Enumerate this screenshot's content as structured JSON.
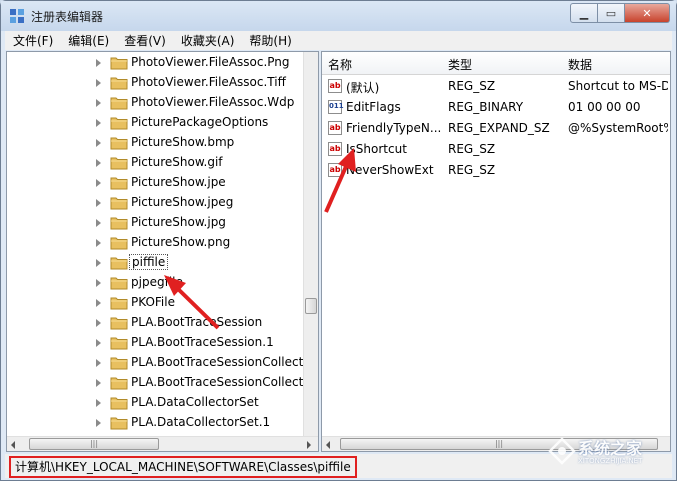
{
  "window": {
    "title": "注册表编辑器"
  },
  "menu": [
    {
      "label": "文件(F)"
    },
    {
      "label": "编辑(E)"
    },
    {
      "label": "查看(V)"
    },
    {
      "label": "收藏夹(A)"
    },
    {
      "label": "帮助(H)"
    }
  ],
  "tree": {
    "items": [
      {
        "label": "PhotoViewer.FileAssoc.Png"
      },
      {
        "label": "PhotoViewer.FileAssoc.Tiff"
      },
      {
        "label": "PhotoViewer.FileAssoc.Wdp"
      },
      {
        "label": "PicturePackageOptions"
      },
      {
        "label": "PictureShow.bmp"
      },
      {
        "label": "PictureShow.gif"
      },
      {
        "label": "PictureShow.jpe"
      },
      {
        "label": "PictureShow.jpeg"
      },
      {
        "label": "PictureShow.jpg"
      },
      {
        "label": "PictureShow.png"
      },
      {
        "label": "piffile",
        "selected": true
      },
      {
        "label": "pjpegfile"
      },
      {
        "label": "PKOFile"
      },
      {
        "label": "PLA.BootTraceSession"
      },
      {
        "label": "PLA.BootTraceSession.1"
      },
      {
        "label": "PLA.BootTraceSessionCollect"
      },
      {
        "label": "PLA.BootTraceSessionCollect"
      },
      {
        "label": "PLA.DataCollectorSet"
      },
      {
        "label": "PLA.DataCollectorSet.1"
      }
    ]
  },
  "values": {
    "columns": {
      "name": "名称",
      "type": "类型",
      "data": "数据"
    },
    "rows": [
      {
        "icon": "string-value-icon",
        "badge": "ab",
        "name": "(默认)",
        "type": "REG_SZ",
        "data": "Shortcut to MS-D"
      },
      {
        "icon": "binary-value-icon",
        "badge": "011",
        "name": "EditFlags",
        "type": "REG_BINARY",
        "data": "01 00 00 00"
      },
      {
        "icon": "string-value-icon",
        "badge": "ab",
        "name": "FriendlyTypeN...",
        "type": "REG_EXPAND_SZ",
        "data": "@%SystemRoot%"
      },
      {
        "icon": "string-value-icon",
        "badge": "ab",
        "name": "IsShortcut",
        "type": "REG_SZ",
        "data": ""
      },
      {
        "icon": "string-value-icon",
        "badge": "ab",
        "name": "NeverShowExt",
        "type": "REG_SZ",
        "data": ""
      }
    ]
  },
  "status": {
    "path": "计算机\\HKEY_LOCAL_MACHINE\\SOFTWARE\\Classes\\piffile"
  },
  "watermark": {
    "text": "系统之家",
    "sub": "XITONGZHIJIA.NET"
  },
  "colors": {
    "highlight": "#e02020",
    "folder": "#e8c060"
  }
}
